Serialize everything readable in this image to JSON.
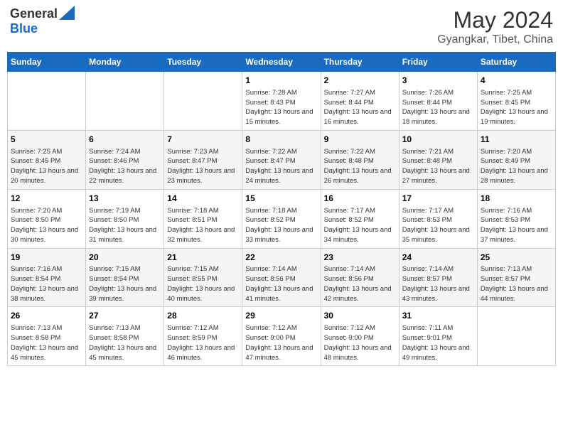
{
  "header": {
    "logo_line1": "General",
    "logo_line2": "Blue",
    "month_year": "May 2024",
    "location": "Gyangkar, Tibet, China"
  },
  "weekdays": [
    "Sunday",
    "Monday",
    "Tuesday",
    "Wednesday",
    "Thursday",
    "Friday",
    "Saturday"
  ],
  "weeks": [
    [
      {
        "day": "",
        "info": ""
      },
      {
        "day": "",
        "info": ""
      },
      {
        "day": "",
        "info": ""
      },
      {
        "day": "1",
        "info": "Sunrise: 7:28 AM\nSunset: 8:43 PM\nDaylight: 13 hours and 15 minutes."
      },
      {
        "day": "2",
        "info": "Sunrise: 7:27 AM\nSunset: 8:44 PM\nDaylight: 13 hours and 16 minutes."
      },
      {
        "day": "3",
        "info": "Sunrise: 7:26 AM\nSunset: 8:44 PM\nDaylight: 13 hours and 18 minutes."
      },
      {
        "day": "4",
        "info": "Sunrise: 7:25 AM\nSunset: 8:45 PM\nDaylight: 13 hours and 19 minutes."
      }
    ],
    [
      {
        "day": "5",
        "info": "Sunrise: 7:25 AM\nSunset: 8:45 PM\nDaylight: 13 hours and 20 minutes."
      },
      {
        "day": "6",
        "info": "Sunrise: 7:24 AM\nSunset: 8:46 PM\nDaylight: 13 hours and 22 minutes."
      },
      {
        "day": "7",
        "info": "Sunrise: 7:23 AM\nSunset: 8:47 PM\nDaylight: 13 hours and 23 minutes."
      },
      {
        "day": "8",
        "info": "Sunrise: 7:22 AM\nSunset: 8:47 PM\nDaylight: 13 hours and 24 minutes."
      },
      {
        "day": "9",
        "info": "Sunrise: 7:22 AM\nSunset: 8:48 PM\nDaylight: 13 hours and 26 minutes."
      },
      {
        "day": "10",
        "info": "Sunrise: 7:21 AM\nSunset: 8:48 PM\nDaylight: 13 hours and 27 minutes."
      },
      {
        "day": "11",
        "info": "Sunrise: 7:20 AM\nSunset: 8:49 PM\nDaylight: 13 hours and 28 minutes."
      }
    ],
    [
      {
        "day": "12",
        "info": "Sunrise: 7:20 AM\nSunset: 8:50 PM\nDaylight: 13 hours and 30 minutes."
      },
      {
        "day": "13",
        "info": "Sunrise: 7:19 AM\nSunset: 8:50 PM\nDaylight: 13 hours and 31 minutes."
      },
      {
        "day": "14",
        "info": "Sunrise: 7:18 AM\nSunset: 8:51 PM\nDaylight: 13 hours and 32 minutes."
      },
      {
        "day": "15",
        "info": "Sunrise: 7:18 AM\nSunset: 8:52 PM\nDaylight: 13 hours and 33 minutes."
      },
      {
        "day": "16",
        "info": "Sunrise: 7:17 AM\nSunset: 8:52 PM\nDaylight: 13 hours and 34 minutes."
      },
      {
        "day": "17",
        "info": "Sunrise: 7:17 AM\nSunset: 8:53 PM\nDaylight: 13 hours and 35 minutes."
      },
      {
        "day": "18",
        "info": "Sunrise: 7:16 AM\nSunset: 8:53 PM\nDaylight: 13 hours and 37 minutes."
      }
    ],
    [
      {
        "day": "19",
        "info": "Sunrise: 7:16 AM\nSunset: 8:54 PM\nDaylight: 13 hours and 38 minutes."
      },
      {
        "day": "20",
        "info": "Sunrise: 7:15 AM\nSunset: 8:54 PM\nDaylight: 13 hours and 39 minutes."
      },
      {
        "day": "21",
        "info": "Sunrise: 7:15 AM\nSunset: 8:55 PM\nDaylight: 13 hours and 40 minutes."
      },
      {
        "day": "22",
        "info": "Sunrise: 7:14 AM\nSunset: 8:56 PM\nDaylight: 13 hours and 41 minutes."
      },
      {
        "day": "23",
        "info": "Sunrise: 7:14 AM\nSunset: 8:56 PM\nDaylight: 13 hours and 42 minutes."
      },
      {
        "day": "24",
        "info": "Sunrise: 7:14 AM\nSunset: 8:57 PM\nDaylight: 13 hours and 43 minutes."
      },
      {
        "day": "25",
        "info": "Sunrise: 7:13 AM\nSunset: 8:57 PM\nDaylight: 13 hours and 44 minutes."
      }
    ],
    [
      {
        "day": "26",
        "info": "Sunrise: 7:13 AM\nSunset: 8:58 PM\nDaylight: 13 hours and 45 minutes."
      },
      {
        "day": "27",
        "info": "Sunrise: 7:13 AM\nSunset: 8:58 PM\nDaylight: 13 hours and 45 minutes."
      },
      {
        "day": "28",
        "info": "Sunrise: 7:12 AM\nSunset: 8:59 PM\nDaylight: 13 hours and 46 minutes."
      },
      {
        "day": "29",
        "info": "Sunrise: 7:12 AM\nSunset: 9:00 PM\nDaylight: 13 hours and 47 minutes."
      },
      {
        "day": "30",
        "info": "Sunrise: 7:12 AM\nSunset: 9:00 PM\nDaylight: 13 hours and 48 minutes."
      },
      {
        "day": "31",
        "info": "Sunrise: 7:11 AM\nSunset: 9:01 PM\nDaylight: 13 hours and 49 minutes."
      },
      {
        "day": "",
        "info": ""
      }
    ]
  ]
}
